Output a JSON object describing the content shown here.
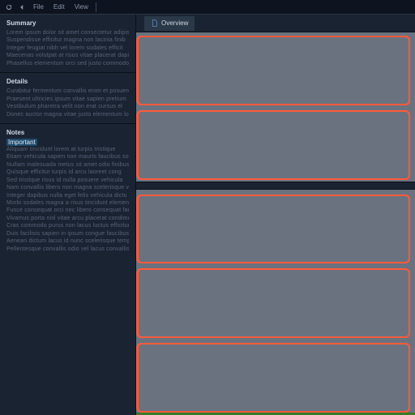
{
  "toolbar": {
    "refresh": "↻",
    "back": "◀",
    "items": [
      "File",
      "Edit",
      "View"
    ],
    "divider_after": true
  },
  "tabs": [
    {
      "label": "Overview",
      "active": true
    }
  ],
  "sections": [
    {
      "title": "Summary",
      "lines": [
        "Lorem ipsum dolor sit amet consectetur adipis",
        "Suspendisse efficitur magna non lacinia finib",
        "Integer feugiat nibh vel lorem sodales efficit",
        "Maecenas volutpat at risus vitae placerat dapib",
        "Phasellus elementum orci sed justo commodo fe"
      ]
    },
    {
      "title": "Details",
      "lines": [
        "Curabitur fermentum convallis enim et posuere",
        "Praesent ultricies ipsum vitae sapien pretium",
        "Vestibulum pharetra velit non erat cursus el",
        "Donec auctor magna vitae justo elementum lo"
      ]
    },
    {
      "title": "Notes",
      "highlight": "Important",
      "lines": [
        "Aliquam tincidunt lorem at turpis tristique",
        "Etiam vehicula sapien non mauris faucibus so",
        "Nullam malesuada metus sit amet odio finibus",
        "Quisque efficitur turpis id arcu laoreet cong",
        "Sed tristique risus id nulla posuere vehicula",
        "Nam convallis libero non magna scelerisque vo",
        "Integer dapibus nulla eget felis vehicula dictu",
        "Morbi sodales magna a risus tincidunt element",
        "Fusce consequat orci nec libero consequat fau",
        "Vivamus porta nisl vitae arcu placerat condime",
        "Cras commodo purus non lacus luctus efficitur",
        "Duis facilisis sapien in ipsum congue faucibus",
        "Aenean dictum lacus id nunc scelerisque tempu",
        "Pellentesque convallis odio vel lacus convallis"
      ]
    }
  ],
  "blocks": [
    {
      "id": "block-1"
    },
    {
      "id": "block-2"
    },
    {
      "id": "block-3"
    },
    {
      "id": "block-4"
    },
    {
      "id": "block-5"
    }
  ]
}
